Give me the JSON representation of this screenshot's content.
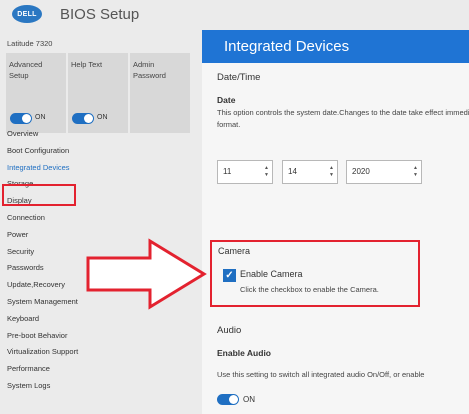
{
  "app": {
    "logo": "DELL",
    "title": "BIOS Setup"
  },
  "sidebar": {
    "model": "Latitude 7320",
    "tiles": [
      {
        "label": "Advanced Setup",
        "toggle": "ON"
      },
      {
        "label": "Help Text",
        "toggle": "ON"
      },
      {
        "label": "Admin Password"
      }
    ],
    "items": [
      {
        "label": "Overview"
      },
      {
        "label": "Boot Configuration"
      },
      {
        "label": "Integrated Devices",
        "active": true
      },
      {
        "label": "Storage"
      },
      {
        "label": "Display"
      },
      {
        "label": "Connection"
      },
      {
        "label": "Power"
      },
      {
        "label": "Security"
      },
      {
        "label": "Passwords"
      },
      {
        "label": "Update,Recovery"
      },
      {
        "label": "System Management"
      },
      {
        "label": "Keyboard"
      },
      {
        "label": "Pre-boot Behavior"
      },
      {
        "label": "Virtualization Support"
      },
      {
        "label": "Performance"
      },
      {
        "label": "System Logs"
      }
    ]
  },
  "main": {
    "title": "Integrated Devices",
    "datetime": {
      "header": "Date/Time",
      "label": "Date",
      "desc": "This option controls the system date.Changes to the date take effect immediately. MM/DD/YYYY format.",
      "month": "11",
      "day": "14",
      "year": "2020"
    },
    "camera": {
      "header": "Camera",
      "checkbox_label": "Enable Camera",
      "checked": true,
      "desc": "Click the checkbox to enable the Camera."
    },
    "audio": {
      "header": "Audio",
      "label": "Enable Audio",
      "desc": "Use this setting to switch all integrated audio On/Off, or enable",
      "toggle": "ON"
    }
  },
  "colors": {
    "accent": "#1f74d4",
    "highlight": "#e3222f",
    "sidebar_bg": "#ebebeb"
  }
}
